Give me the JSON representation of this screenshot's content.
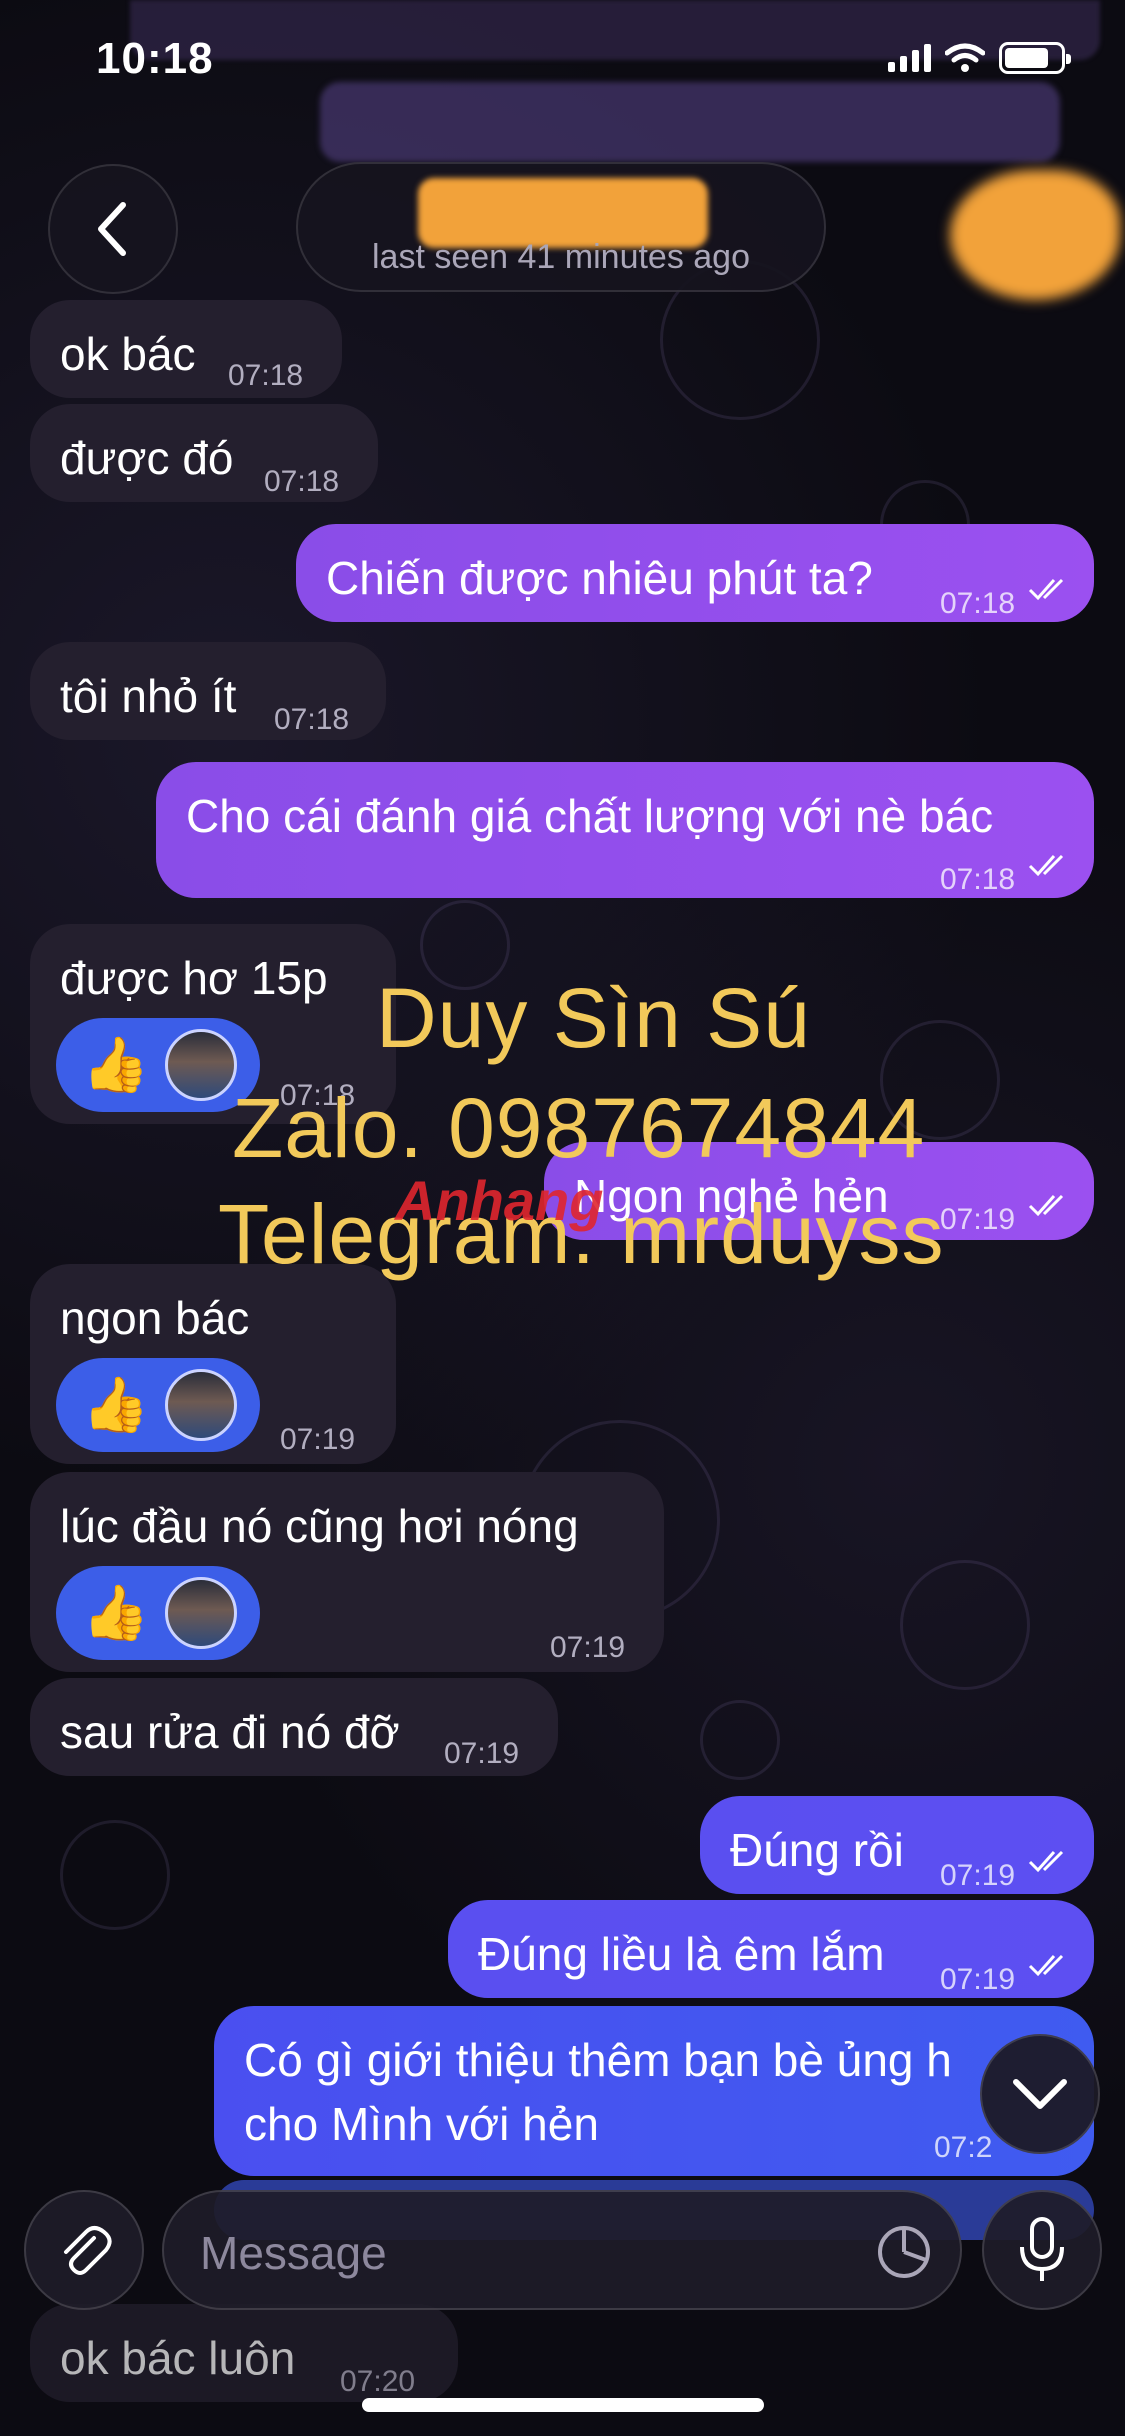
{
  "status_bar": {
    "time": "10:18"
  },
  "header": {
    "name": "",
    "status": "last seen 41 minutes ago"
  },
  "messages": [
    {
      "text": "ok bác",
      "time": "07:18"
    },
    {
      "text": "được đó",
      "time": "07:18"
    },
    {
      "text": "Chiến được nhiêu phút ta?",
      "time": "07:18"
    },
    {
      "text": "tôi nhỏ ít",
      "time": "07:18"
    },
    {
      "text": "Cho cái đánh giá chất lượng với nè bác",
      "time": "07:18"
    },
    {
      "text": "được hơ 15p",
      "time": "07:18"
    },
    {
      "text": "Ngon nghẻ hẻn",
      "time": "07:19"
    },
    {
      "text": "ngon bác",
      "time": "07:19"
    },
    {
      "text": "lúc đầu nó cũng hơi nóng",
      "time": "07:19"
    },
    {
      "text": "sau rửa đi nó đỡ",
      "time": "07:19"
    },
    {
      "text": "Đúng rồi",
      "time": "07:19"
    },
    {
      "text": "Đúng liều là êm lắm",
      "time": "07:19"
    },
    {
      "text": "Có gì giới thiệu thêm bạn bè ủng h",
      "text2": "cho Mình với hẻn",
      "time": "07:2"
    },
    {
      "text": "ok bác luôn",
      "time": "07:20"
    }
  ],
  "reaction": {
    "emoji": "👍"
  },
  "watermark": {
    "line1": "Duy Sìn Sú",
    "line2": "Zalo. 0987674844",
    "line3": "Telegram. mrduyss",
    "logo": "Anhang"
  },
  "input": {
    "placeholder": "Message"
  },
  "colors": {
    "incoming": "#241f2e",
    "outgoing": "#9b50f0",
    "reaction": "#3c5ee8",
    "watermark": "#f2c95a"
  }
}
